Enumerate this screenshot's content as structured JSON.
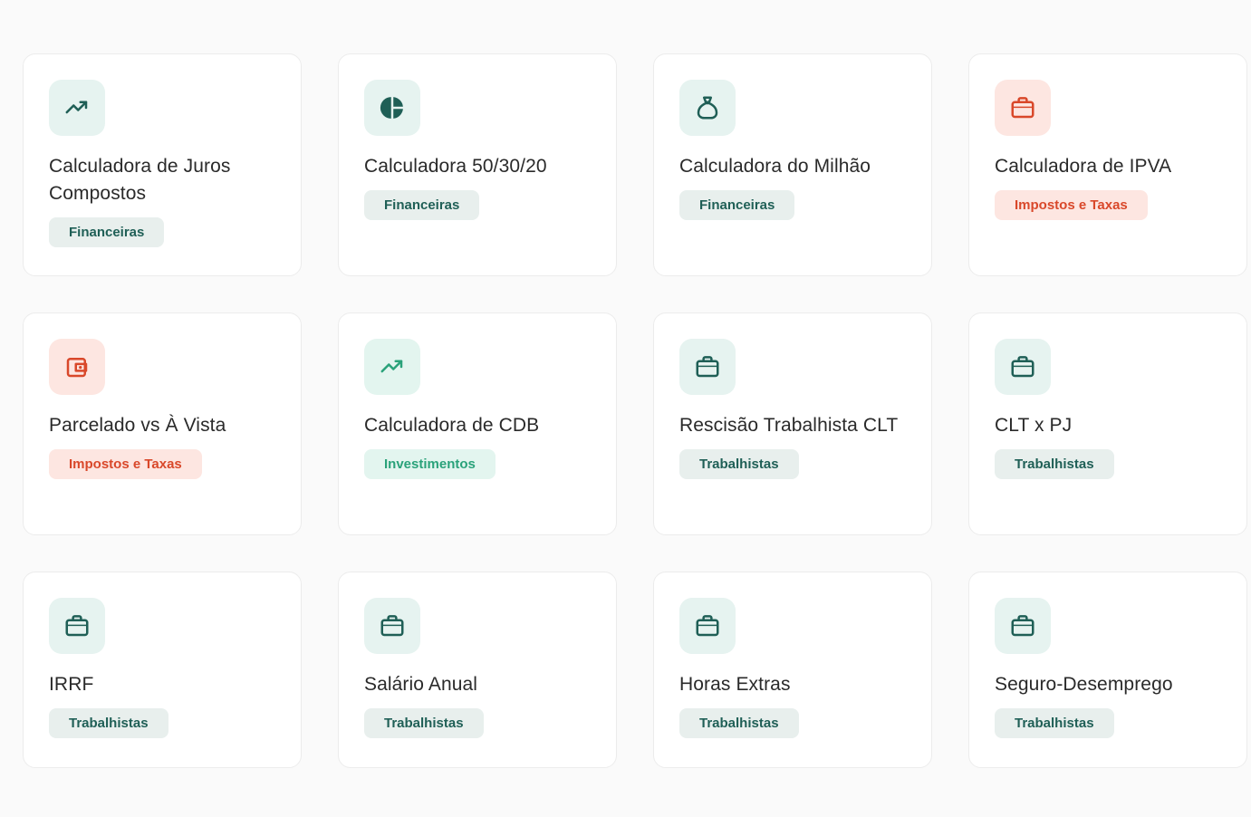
{
  "colors": {
    "teal_dark": "#1f5f56",
    "teal_bg": "#e6f3f0",
    "green": "#2aa27a",
    "green_bg": "#e3f5ef",
    "red": "#d9482a",
    "red_bg": "#fde6e1",
    "badge_gray_bg": "#e8efed"
  },
  "cards": [
    {
      "title": "Calculadora de Juros Compostos",
      "badge": "Financeiras",
      "icon": "trending-up-icon",
      "variant": "teal"
    },
    {
      "title": "Calculadora 50/30/20",
      "badge": "Financeiras",
      "icon": "pie-chart-icon",
      "variant": "teal"
    },
    {
      "title": "Calculadora do Milhão",
      "badge": "Financeiras",
      "icon": "money-bag-icon",
      "variant": "teal"
    },
    {
      "title": "Calculadora de IPVA",
      "badge": "Impostos e Taxas",
      "icon": "briefcase-icon",
      "variant": "red"
    },
    {
      "title": "Parcelado vs À Vista",
      "badge": "Impostos e Taxas",
      "icon": "wallet-icon",
      "variant": "red"
    },
    {
      "title": "Calculadora de CDB",
      "badge": "Investimentos",
      "icon": "trending-up-icon",
      "variant": "green"
    },
    {
      "title": "Rescisão Trabalhista CLT",
      "badge": "Trabalhistas",
      "icon": "briefcase-icon",
      "variant": "teal"
    },
    {
      "title": "CLT x PJ",
      "badge": "Trabalhistas",
      "icon": "briefcase-icon",
      "variant": "teal"
    },
    {
      "title": "IRRF",
      "badge": "Trabalhistas",
      "icon": "briefcase-icon",
      "variant": "teal"
    },
    {
      "title": "Salário Anual",
      "badge": "Trabalhistas",
      "icon": "briefcase-icon",
      "variant": "teal"
    },
    {
      "title": "Horas Extras",
      "badge": "Trabalhistas",
      "icon": "briefcase-icon",
      "variant": "teal"
    },
    {
      "title": "Seguro-Desemprego",
      "badge": "Trabalhistas",
      "icon": "briefcase-icon",
      "variant": "teal"
    }
  ]
}
